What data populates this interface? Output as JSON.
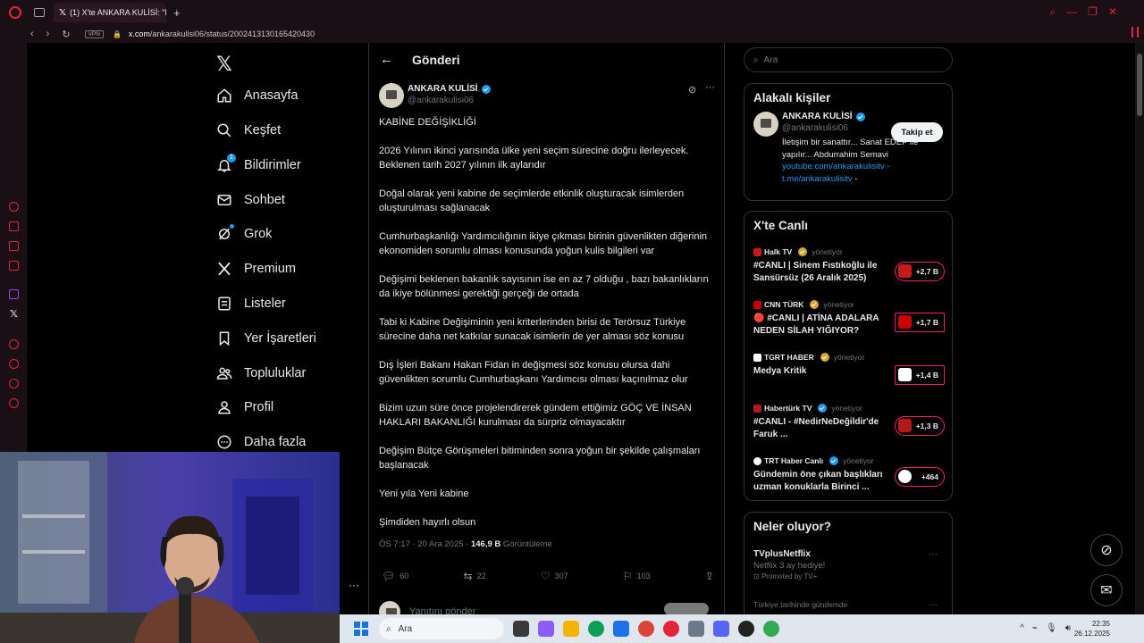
{
  "browser": {
    "tab_title": "(1) X'te ANKARA KULİSİ: \"K",
    "vpn_label": "VPN",
    "url_host": "x.com",
    "url_path": "/ankarakulisi06/status/2002413130165420430"
  },
  "nav": {
    "items": [
      {
        "label": "Anasayfa",
        "icon": "home-icon"
      },
      {
        "label": "Keşfet",
        "icon": "search-icon"
      },
      {
        "label": "Bildirimler",
        "icon": "bell-icon",
        "badge": "1"
      },
      {
        "label": "Sohbet",
        "icon": "mail-icon"
      },
      {
        "label": "Grok",
        "icon": "grok-icon"
      },
      {
        "label": "Premium",
        "icon": "x-icon"
      },
      {
        "label": "Listeler",
        "icon": "list-icon"
      },
      {
        "label": "Yer İşaretleri",
        "icon": "bookmark-icon"
      },
      {
        "label": "Topluluklar",
        "icon": "people-icon"
      },
      {
        "label": "Profil",
        "icon": "person-icon"
      },
      {
        "label": "Daha fazla",
        "icon": "more-circle-icon"
      }
    ]
  },
  "main": {
    "title": "Gönderi",
    "author": {
      "name": "ANKARA KULİSİ",
      "handle": "@ankarakulisi06"
    },
    "paragraphs": [
      "KABİNE DEĞİŞİKLİĞİ",
      "2026 Yılının ikinci yarısında ülke yeni seçim sürecine doğru ilerleyecek. Beklenen tarih 2027 yılının ilk aylarıdır",
      "Doğal olarak yeni kabine de seçimlerde etkinlik oluşturacak isimlerden oluşturulması sağlanacak",
      "Cumhurbaşkanlığı Yardımcılığının ikiye çıkması birinin güvenlikten diğerinin ekonomiden sorumlu olması konusunda yoğun kulis bilgileri var",
      "Değişimi beklenen bakanlık sayısının ise en az 7 olduğu , bazı bakanlıkların da ikiye bölünmesi gerektiği gerçeği de ortada",
      "Tabi ki Kabine Değişiminin yeni kriterlerinden birisi de Terörsuz Türkiye sürecine daha net katkılar sunacak isimlerin de yer alması söz konusu",
      "Dış İşleri Bakanı Hakan Fidan in değişmesi söz konusu olursa dahi güvenlikten sorumlu  Cumhurbaşkanı Yardımcısı olması kaçınılmaz olur",
      "Bizim uzun süre önce projelendirerek  gündem ettiğimiz GÖÇ VE İNSAN HAKLARI BAKANLIĞI kurulması da sürpriz olmayacaktır",
      "Değişim  Bütçe Görüşmeleri bitiminden sonra  yoğun bir şekilde çalışmaları başlanacak",
      "Yeni yıla Yeni kabine",
      "Şimdiden hayırlı olsun"
    ],
    "meta": {
      "time": "ÖS 7:17 · 20 Ara 2025 · ",
      "views": "146,9 B",
      "views_label": " Görüntüleme"
    },
    "actions": {
      "replies": "60",
      "reposts": "22",
      "likes": "307",
      "bookmarks": "103"
    },
    "reply_placeholder": "Yanıtını gönder"
  },
  "right": {
    "search_placeholder": "Ara",
    "related": {
      "title": "Alakalı kişiler",
      "name": "ANKARA KULİSİ",
      "handle": "@ankarakulisi06",
      "follow_label": "Takip et",
      "bio": "İletişim bir sanattır... Sanat EDEP ile yapılır... Abdurrahim Semavi",
      "link1": "youtube.com/ankarakulisitv",
      "link1_suffix": " -",
      "link2": "t.me/ankarakulisitv",
      "link2_suffix": " -"
    },
    "live": {
      "title": "X'te Canlı",
      "host_suffix": "yönetiyor",
      "items": [
        {
          "host": "Halk TV",
          "title": "#CANLI | Sinem Fıstıkoğlu ile Sansürsüz (26 Aralık 2025)",
          "count": "+2,7 B",
          "color": "#c61b1b"
        },
        {
          "host": "CNN TÜRK",
          "title": "🔴 #CANLI | ATİNA ADALARA NEDEN SİLAH YIĞIYOR?",
          "count": "+1,7 B",
          "color": "#cc0000"
        },
        {
          "host": "TGRT HABER",
          "title": "Medya Kritik",
          "count": "+1,4 B",
          "color": "#ffffff"
        },
        {
          "host": "Habertürk TV",
          "title": "#CANLI - #NedirNeDeğildir'de Faruk ...",
          "count": "+1,3 B",
          "color": "#b01a1a"
        },
        {
          "host": "TRT Haber Canlı",
          "title": "Gündemin öne çıkan başlıkları uzman konuklarla Birinci ...",
          "count": "+464",
          "color": "#ffffff"
        }
      ]
    },
    "trends": {
      "title": "Neler oluyor?",
      "item1_name": "TVplusNetflix",
      "item1_desc": "Netflix 3 ay hediye!",
      "item1_promo": "Promoted by TV+",
      "item2_context": "Türkiye tarihinde gündemde"
    }
  },
  "taskbar": {
    "search_placeholder": "Ara",
    "time": "22:35",
    "date": "26.12.2025"
  }
}
